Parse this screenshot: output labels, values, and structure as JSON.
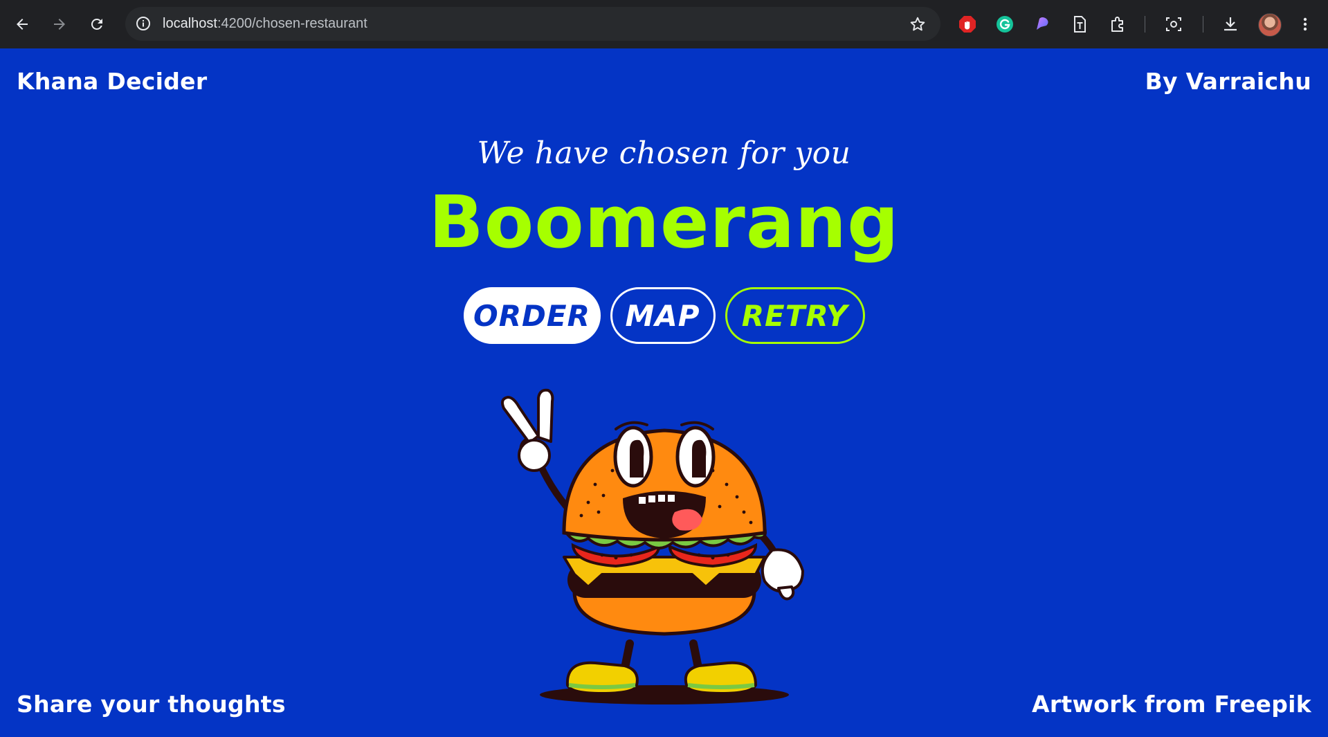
{
  "browser": {
    "url_host": "localhost",
    "url_path": ":4200/chosen-restaurant"
  },
  "header": {
    "app_title": "Khana Decider",
    "author": "By Varraichu"
  },
  "main": {
    "subtitle": "We have chosen for you",
    "restaurant_name": "Boomerang",
    "buttons": {
      "order": "ORDER",
      "map": "MAP",
      "retry": "RETRY"
    },
    "illustration": "burger-character-illustration"
  },
  "footer": {
    "feedback": "Share your thoughts",
    "credit": "Artwork from Freepik"
  },
  "colors": {
    "background": "#0434c5",
    "accent": "#a6ff00",
    "text": "#ffffff",
    "chrome": "#202124"
  }
}
